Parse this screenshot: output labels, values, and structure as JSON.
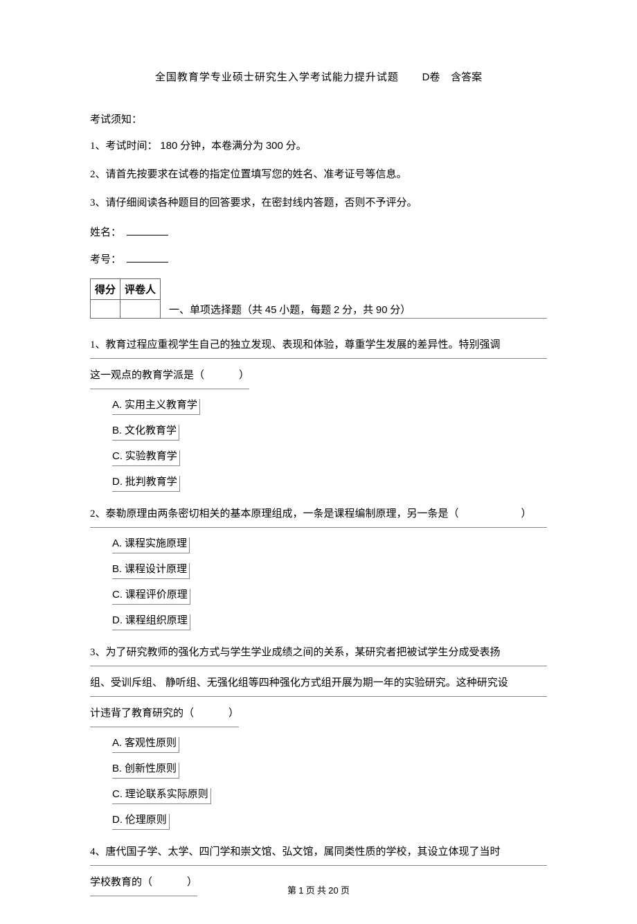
{
  "title": {
    "main": "全国教育学专业硕士研究生入学考试能力提升试题",
    "paper": "D卷",
    "answer_note": "含答案"
  },
  "instructions": {
    "heading": "考试须知：",
    "items": [
      {
        "num": "1、",
        "pre": "考试时间：",
        "t1": "180",
        "mid1": "分钟，本卷满分为",
        "t2": "300",
        "suf": "分。"
      },
      {
        "num": "2、",
        "text": "请首先按要求在试卷的指定位置填写您的姓名、准考证号等信息。"
      },
      {
        "num": "3、",
        "text": "请仔细阅读各种题目的回答要求，在密封线内答题，否则不予评分。"
      }
    ],
    "name_label": "姓名：",
    "id_label": "考号："
  },
  "score_table": {
    "score": "得分",
    "grader": "评卷人"
  },
  "section": {
    "prefix": "一、单项选择题（共",
    "count": "45",
    "mid1": "小题，每题",
    "per": "2",
    "mid2": "分，共",
    "total": "90",
    "suffix": "分）"
  },
  "questions": [
    {
      "num": "1、",
      "stem_lines": [
        "教育过程应重视学生自己的独立发现、表现和体验，尊重学生发展的差异性。特别强调",
        "这一观点的教育学派是（"
      ],
      "options": [
        {
          "l": "A.",
          "t": "实用主义教育学"
        },
        {
          "l": "B.",
          "t": "文化教育学"
        },
        {
          "l": "C.",
          "t": "实验教育学"
        },
        {
          "l": "D.",
          "t": "批判教育学"
        }
      ]
    },
    {
      "num": "2、",
      "stem_lines": [
        "泰勒原理由两条密切相关的基本原理组成，一条是课程编制原理，另一条是（"
      ],
      "wide_paren": true,
      "options": [
        {
          "l": "A.",
          "t": "课程实施原理"
        },
        {
          "l": "B.",
          "t": "课程设计原理"
        },
        {
          "l": "C.",
          "t": "课程评价原理"
        },
        {
          "l": "D.",
          "t": "课程组织原理"
        }
      ]
    },
    {
      "num": "3、",
      "stem_lines": [
        "为了研究教师的强化方式与学生学业成绩之间的关系，某研究者把被试学生分成受表扬",
        "组、受训斥组、  静听组、无强化组等四种强化方式组开展为期一年的实验研究。这种研究设",
        "计违背了教育研究的（"
      ],
      "options": [
        {
          "l": "A.",
          "t": "客观性原则"
        },
        {
          "l": "B.",
          "t": "创新性原则"
        },
        {
          "l": "C.",
          "t": "理论联系实际原则"
        },
        {
          "l": "D.",
          "t": "伦理原则"
        }
      ]
    },
    {
      "num": "4、",
      "stem_lines": [
        "唐代国子学、太学、四门学和崇文馆、弘文馆，属同类性质的学校，其设立体现了当时",
        "学校教育的（"
      ],
      "options": []
    }
  ],
  "footer": {
    "pre": "第",
    "cur": "1",
    "mid": "页 共",
    "total": "20",
    "suf": "页"
  }
}
